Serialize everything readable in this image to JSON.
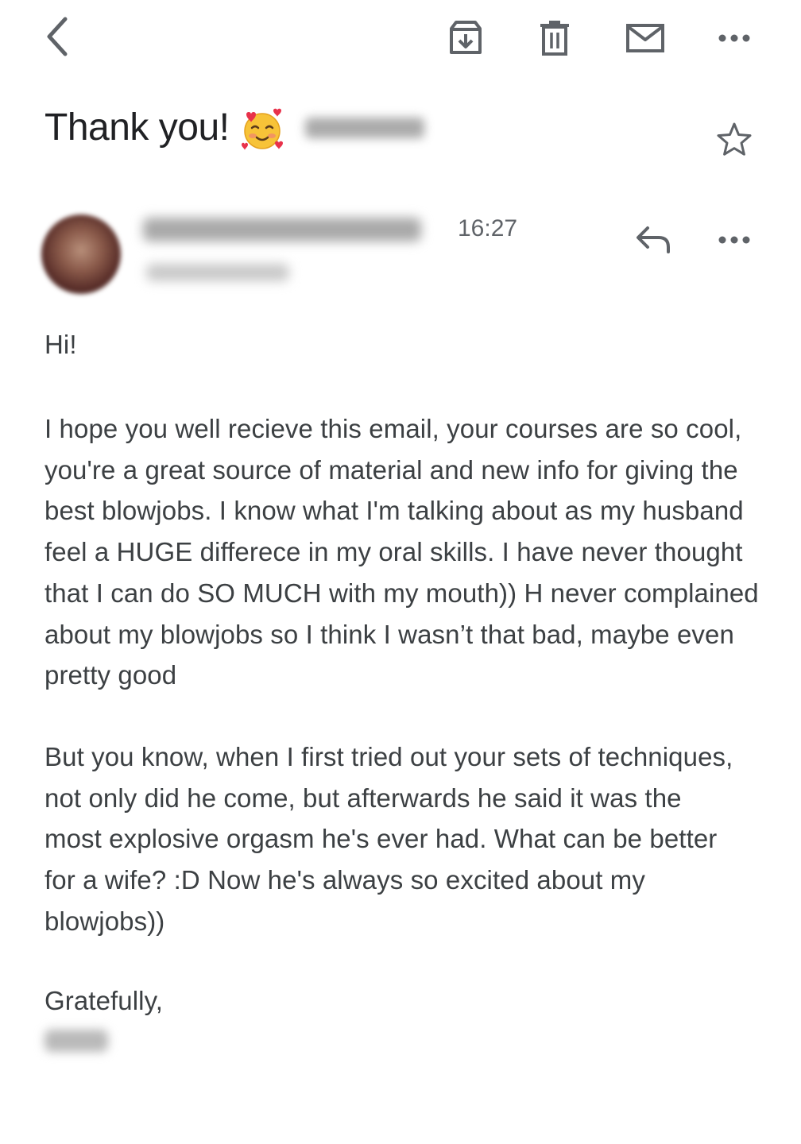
{
  "toolbar": {
    "icons": [
      "back-icon",
      "archive-icon",
      "trash-icon",
      "mail-icon",
      "more-icon"
    ],
    "icon_color": "#5f6368"
  },
  "email": {
    "subject": "Thank you!",
    "subject_emoji": "🥰",
    "time": "16:27",
    "greeting": "Hi!",
    "paragraph_1": "I hope you well recieve this email, your courses are so cool, you're a great source of material and new info for giving the best blowjobs. I know what I'm talking about as my husband feel a HUGE differece in my oral skills. I have never thought that I can do SO MUCH with my mouth)) H never complained about my blowjobs so I think I wasn’t that bad, maybe even pretty good",
    "paragraph_2": "But you know, when I first tried out your sets of techniques, not only did he come, but afterwards he said it was the most explosive orgasm he's ever had. What can be better for a wife? :D Now he's always so excited about my blowjobs))",
    "closing": "Gratefully,"
  },
  "colors": {
    "text_primary": "#202124",
    "text_body": "#3c4043",
    "text_secondary": "#5f6368",
    "background": "#ffffff"
  }
}
